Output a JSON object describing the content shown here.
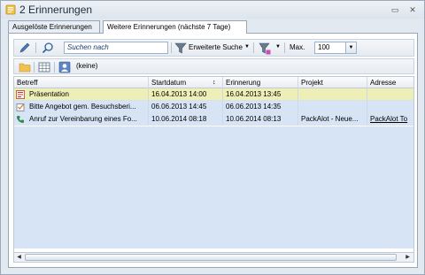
{
  "window": {
    "title": "2 Erinnerungen",
    "close_label": "✕"
  },
  "tabs": [
    {
      "label": "Ausgelöste Erinnerungen",
      "active": false
    },
    {
      "label": "Weitere Erinnerungen (nächste 7 Tage)",
      "active": true
    }
  ],
  "toolbar": {
    "search_placeholder": "Suchen nach",
    "advanced_search_label": "Erweiterte Suche",
    "max_label": "Max.",
    "max_value": "100",
    "filter_label": "(keine)"
  },
  "grid": {
    "columns": [
      "Betreff",
      "Startdatum",
      "Erinnerung",
      "Projekt",
      "Adresse"
    ],
    "rows": [
      {
        "icon": "presentation-icon",
        "betreff": "Präsentation",
        "start": "16.04.2013 14:00",
        "erinnerung": "16.04.2013 13:45",
        "projekt": "",
        "adresse": "",
        "selected": true
      },
      {
        "icon": "task-icon",
        "betreff": "Bitte Angebot gem. Besuchsberi...",
        "start": "06.06.2013 14:45",
        "erinnerung": "06.06.2013 14:35",
        "projekt": "",
        "adresse": "",
        "selected": false
      },
      {
        "icon": "phone-icon",
        "betreff": "Anruf zur Vereinbarung eines Fo...",
        "start": "10.06.2014 08:18",
        "erinnerung": "10.06.2014 08:13",
        "projekt": "PackAlot - Neue...",
        "adresse": "PackAlot To",
        "selected": false
      }
    ]
  },
  "colors": {
    "selected_row": "#eeefb7",
    "row": "#d7e4f6",
    "accent": "#1b3b73"
  }
}
